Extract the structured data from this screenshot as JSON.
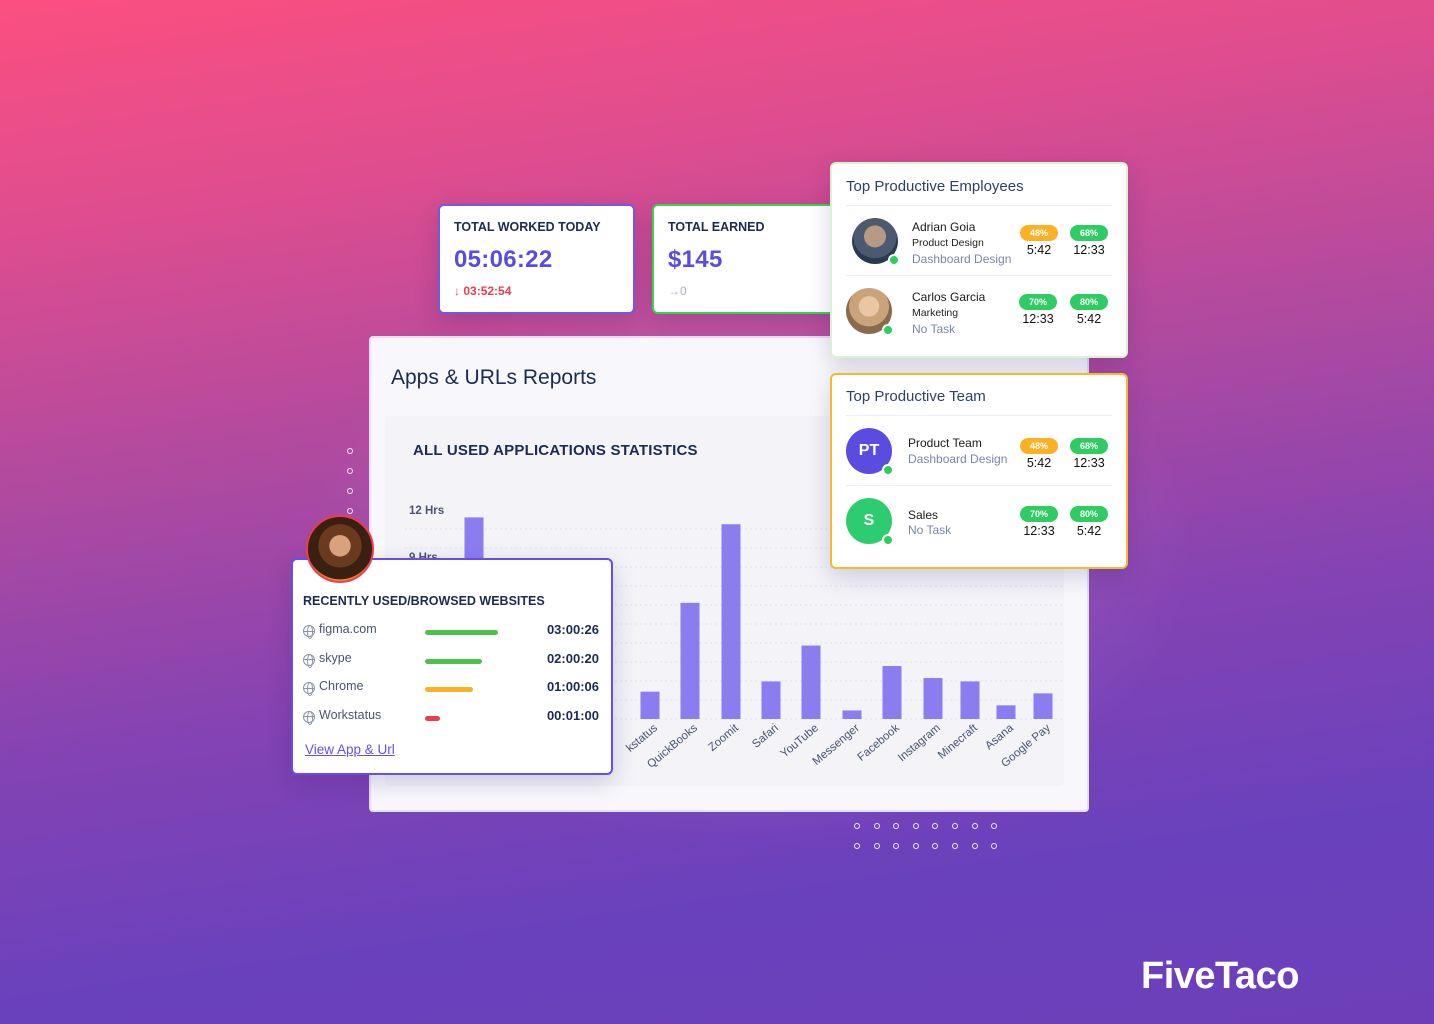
{
  "colors": {
    "accent": "#5b4ce0",
    "bar": "#8b7cf0",
    "green": "#2ecc63",
    "orange": "#fbb124",
    "red": "#ef3b4e"
  },
  "stats": {
    "worked": {
      "label": "TOTAL WORKED TODAY",
      "value": "05:06:22",
      "change": "03:52:54",
      "change_icon": "arrow-down-icon"
    },
    "earned": {
      "label": "TOTAL EARNED",
      "value": "$145",
      "change": "0",
      "change_icon": "arrow-right-icon"
    }
  },
  "report": {
    "title": "Apps & URLs Reports",
    "panel_title": "ALL USED APPLICATIONS STATISTICS"
  },
  "chart_data": {
    "type": "bar",
    "ytick_labels": [
      "12 Hrs",
      "9 Hrs"
    ],
    "categories": [
      "",
      "Workstatus",
      "QuickBooks",
      "Zoomit",
      "Safari",
      "YouTube",
      "Messenger",
      "Facebook",
      "Instagram",
      "Minecraft",
      "Asana",
      "Google Pay"
    ],
    "category_labels": [
      "",
      "kstatus",
      "QuickBooks",
      "Zoomit",
      "Safari",
      "YouTube",
      "Messenger",
      "Facebook",
      "Instagram",
      "Minecraft",
      "Asana",
      "Google Pay"
    ],
    "values": [
      11.8,
      1.6,
      6.8,
      11.4,
      2.2,
      4.3,
      0.5,
      3.1,
      2.4,
      2.2,
      0.8,
      1.5
    ],
    "ylim": [
      0,
      12
    ],
    "grid": true
  },
  "websites": {
    "title": "RECENTLY USED/BROWSED WEBSITES",
    "items": [
      {
        "name": "figma.com",
        "time": "03:00:26",
        "fraction": 1.0,
        "color": "#4cc24a"
      },
      {
        "name": "skype",
        "time": "02:00:20",
        "fraction": 0.78,
        "color": "#4cc24a"
      },
      {
        "name": "Chrome",
        "time": "01:00:06",
        "fraction": 0.66,
        "color": "#fbb124"
      },
      {
        "name": "Workstatus",
        "time": "00:01:00",
        "fraction": 0.2,
        "color": "#ef3b4e"
      }
    ],
    "link": "View App & Url"
  },
  "employees": {
    "title": "Top Productive Employees",
    "items": [
      {
        "name": "Adrian Goia",
        "dept": "Product Design",
        "task": "Dashboard Design",
        "p1": "48%",
        "p1_color": "#fbb124",
        "t1": "5:42",
        "p2": "68%",
        "p2_color": "#2ecc63",
        "t2": "12:33"
      },
      {
        "name": "Carlos Garcia",
        "dept": "Marketing",
        "task": "No Task",
        "p1": "70%",
        "p1_color": "#2ecc63",
        "t1": "12:33",
        "p2": "80%",
        "p2_color": "#2ecc63",
        "t2": "5:42"
      }
    ]
  },
  "team": {
    "title": "Top Productive Team",
    "items": [
      {
        "initials": "PT",
        "avatar_color": "#5b4ce0",
        "name": "Product Team",
        "task": "Dashboard Design",
        "p1": "48%",
        "p1_color": "#fbb124",
        "t1": "5:42",
        "p2": "68%",
        "p2_color": "#2ecc63",
        "t2": "12:33"
      },
      {
        "initials": "S",
        "avatar_color": "#2ecc71",
        "name": "Sales",
        "task": "No Task",
        "p1": "70%",
        "p1_color": "#2ecc63",
        "t1": "12:33",
        "p2": "80%",
        "p2_color": "#2ecc63",
        "t2": "5:42"
      }
    ]
  },
  "brand": {
    "logo": "FiveTaco"
  }
}
